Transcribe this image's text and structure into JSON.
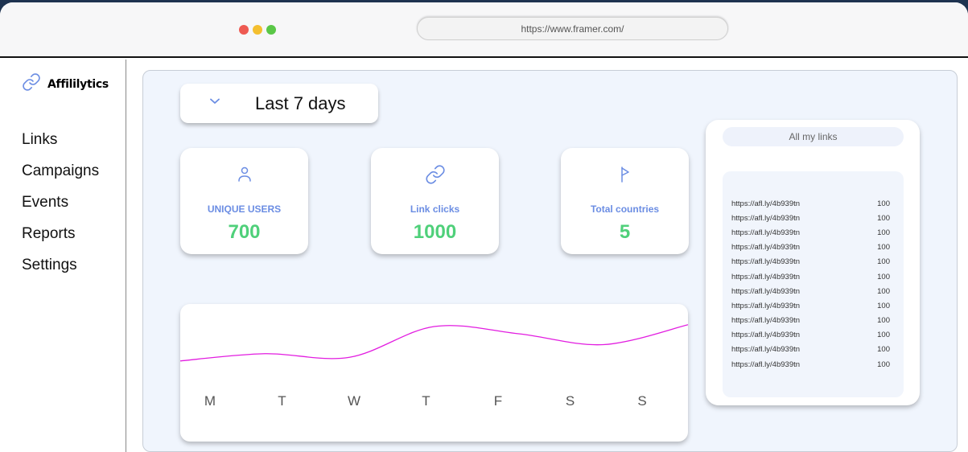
{
  "browser": {
    "url": "https://www.framer.com/",
    "dot_colors": [
      "#ee5a52",
      "#f4bf2f",
      "#5ac747"
    ]
  },
  "app": {
    "name": "Affililytics",
    "logo_icon": "link-icon"
  },
  "nav": [
    "Links",
    "Campaigns",
    "Events",
    "Reports",
    "Settings"
  ],
  "date_range": {
    "label": "Last 7 days"
  },
  "stats": [
    {
      "icon": "user-icon",
      "label": "UNIQUE USERS",
      "value": "700"
    },
    {
      "icon": "link-icon",
      "label": "Link clicks",
      "value": "1000"
    },
    {
      "icon": "flag-icon",
      "label": "Total countries",
      "value": "5"
    }
  ],
  "colors": {
    "accent": "#6b8de3",
    "value_green": "#4fd07a",
    "line": "#e21de0"
  },
  "chart_data": {
    "type": "line",
    "x": [
      "M",
      "T",
      "W",
      "T",
      "F",
      "S",
      "S"
    ],
    "series": [
      {
        "values": [
          53,
          57,
          55,
          72,
          68,
          62,
          73
        ]
      }
    ],
    "ylim": [
      40,
      80
    ],
    "grid": false,
    "legend": "none"
  },
  "links_panel": {
    "title": "All my links",
    "rows": [
      {
        "url": "https://afl.ly/4b939tn",
        "count": "100"
      },
      {
        "url": "https://afl.ly/4b939tn",
        "count": "100"
      },
      {
        "url": "https://afl.ly/4b939tn",
        "count": "100"
      },
      {
        "url": "https://afl.ly/4b939tn",
        "count": "100"
      },
      {
        "url": "https://afl.ly/4b939tn",
        "count": "100"
      },
      {
        "url": "https://afl.ly/4b939tn",
        "count": "100"
      },
      {
        "url": "https://afl.ly/4b939tn",
        "count": "100"
      },
      {
        "url": "https://afl.ly/4b939tn",
        "count": "100"
      },
      {
        "url": "https://afl.ly/4b939tn",
        "count": "100"
      },
      {
        "url": "https://afl.ly/4b939tn",
        "count": "100"
      },
      {
        "url": "https://afl.ly/4b939tn",
        "count": "100"
      },
      {
        "url": "https://afl.ly/4b939tn",
        "count": "100"
      }
    ]
  }
}
